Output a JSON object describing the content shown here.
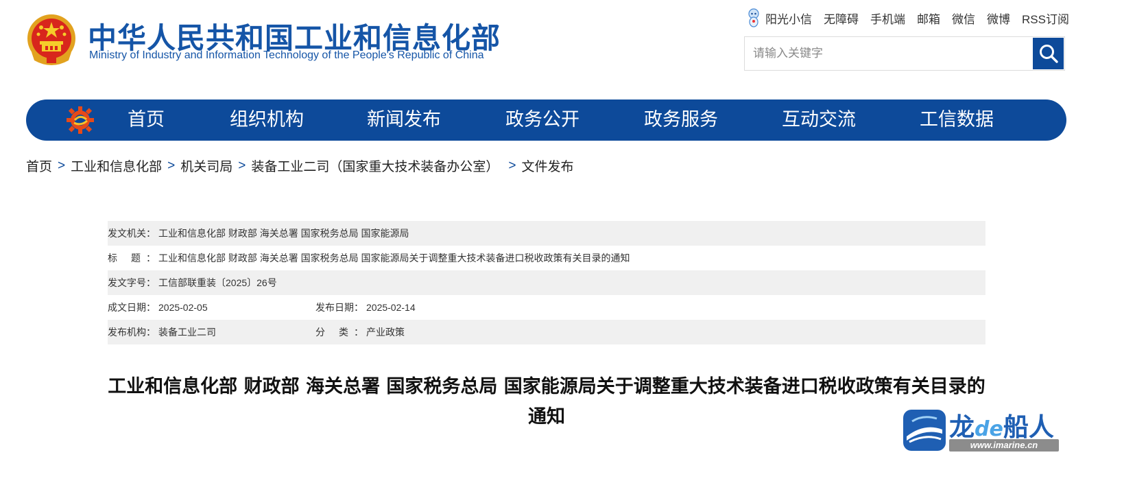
{
  "header": {
    "title_cn": "中华人民共和国工业和信息化部",
    "title_en": "Ministry of Industry and Information Technology of the People's Republic of China",
    "emblem_icon": "national-emblem-icon"
  },
  "top_links": [
    "阳光小信",
    "无障碍",
    "手机端",
    "邮箱",
    "微信",
    "微博",
    "RSS订阅"
  ],
  "search": {
    "placeholder": "请输入关键字",
    "value": "",
    "icon": "search-icon"
  },
  "nav": {
    "logo_icon": "gear-logo-icon",
    "items": [
      "首页",
      "组织机构",
      "新闻发布",
      "政务公开",
      "政务服务",
      "互动交流",
      "工信数据"
    ]
  },
  "breadcrumb": [
    "首页",
    "工业和信息化部",
    "机关司局",
    "装备工业二司（国家重大技术装备办公室）",
    "文件发布"
  ],
  "breadcrumb_separator": ">",
  "info": {
    "issuer_label": "发文机关：",
    "issuer": "工业和信息化部 财政部 海关总署 国家税务总局 国家能源局",
    "title_label": "标 题：",
    "title": "工业和信息化部 财政部 海关总署 国家税务总局 国家能源局关于调整重大技术装备进口税收政策有关目录的通知",
    "doc_no_label": "发文字号：",
    "doc_no": "工信部联重装〔2025〕26号",
    "created_label": "成文日期：",
    "created": "2025-02-05",
    "published_label": "发布日期：",
    "published": "2025-02-14",
    "agency_label": "发布机构：",
    "agency": "装备工业二司",
    "category_label": "分 类：",
    "category": "产业政策"
  },
  "article": {
    "title": "工业和信息化部 财政部 海关总署 国家税务总局 国家能源局关于调整重大技术装备进口税收政策有关目录的通知"
  },
  "watermark": {
    "brand_a": "龙",
    "brand_de": "de",
    "brand_b": "船人",
    "url": "www.imarine.cn"
  },
  "colors": {
    "primary": "#0d4a9a",
    "title_blue": "#1555a7",
    "row_shade": "#f0f0f0"
  }
}
